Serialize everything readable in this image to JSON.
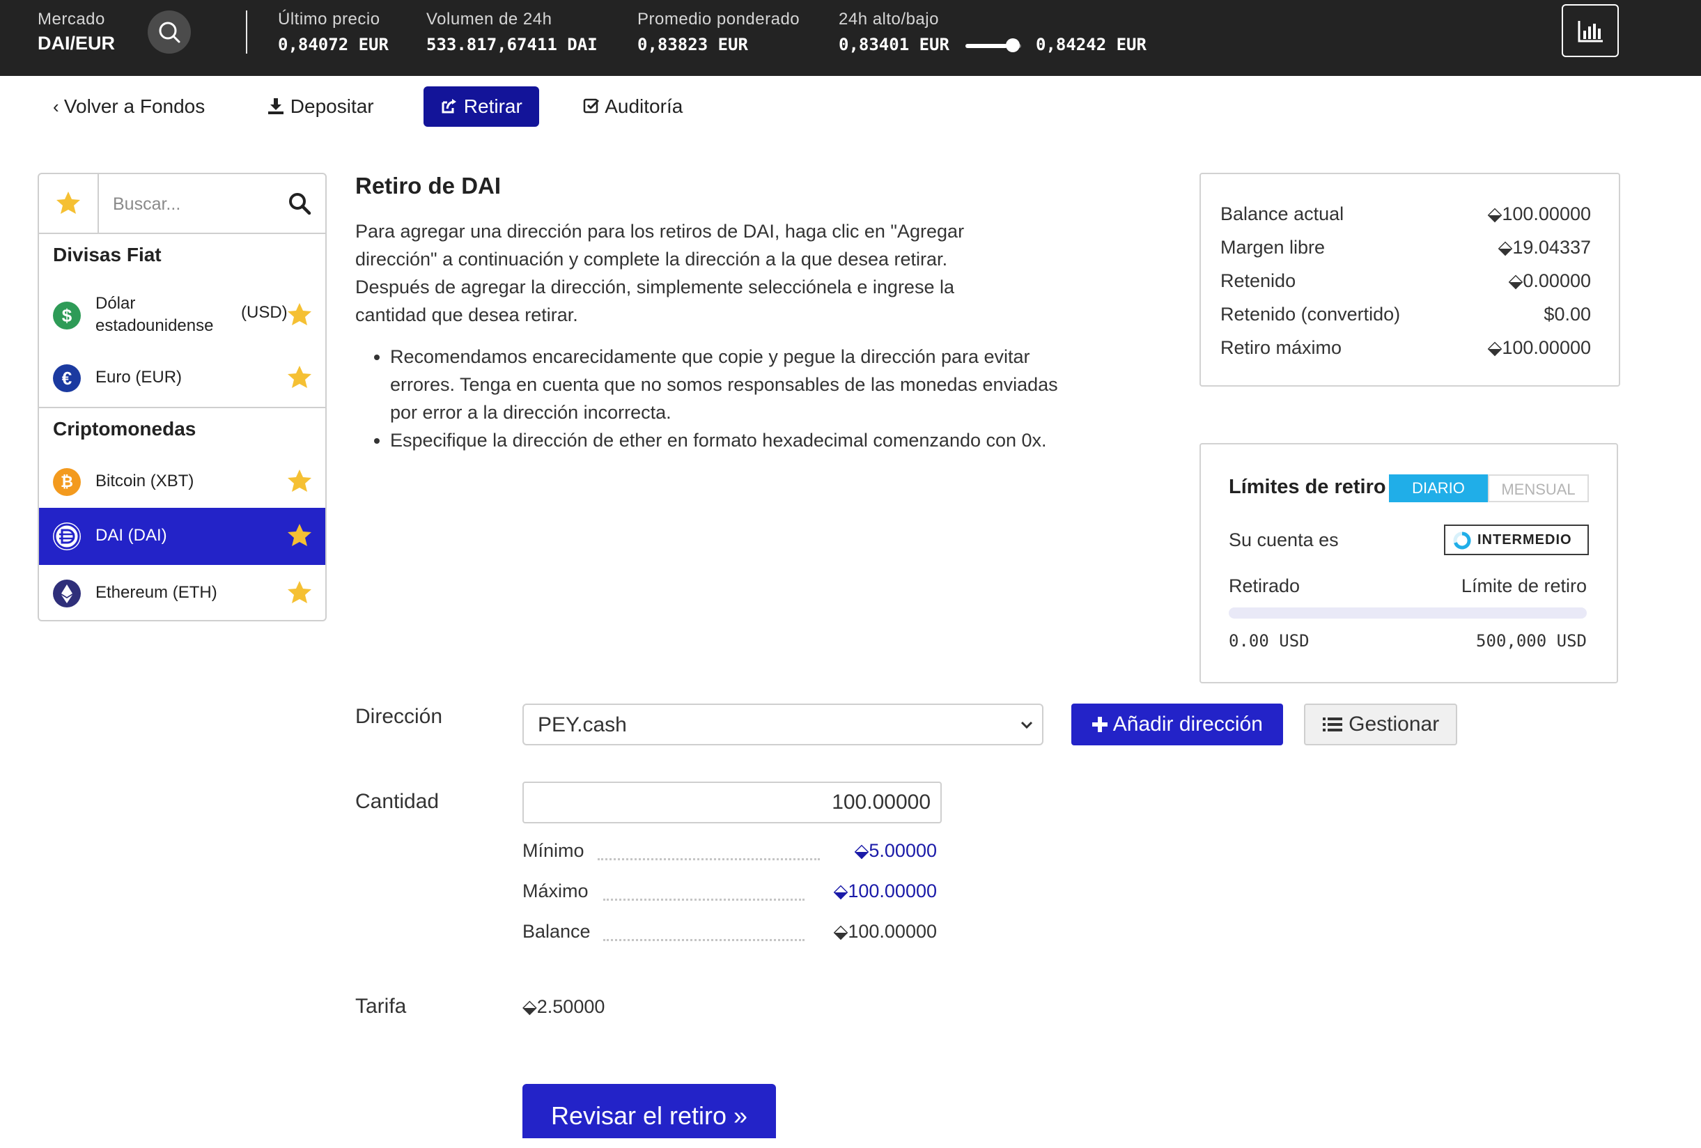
{
  "topbar": {
    "market_label": "Mercado",
    "market_value": "DAI/EUR",
    "last_price_label": "Último precio",
    "last_price_value": "0,84072 EUR",
    "volume_label": "Volumen de 24h",
    "volume_value": "533.817,67411 DAI",
    "weighted_label": "Promedio ponderado",
    "weighted_value": "0,83823 EUR",
    "highlow_label": "24h alto/bajo",
    "low_value": "0,83401 EUR",
    "high_value": "0,84242 EUR",
    "range_fraction": 0.75
  },
  "nav": {
    "back": "Volver a Fondos",
    "deposit": "Depositar",
    "withdraw": "Retirar",
    "audit": "Auditoría"
  },
  "sidebar": {
    "search_placeholder": "Buscar...",
    "fiat_heading": "Divisas Fiat",
    "crypto_heading": "Criptomonedas",
    "usd_name": "Dólar estadounidense",
    "usd_code": "(USD)",
    "eur_name": "Euro (EUR)",
    "xbt_name": "Bitcoin (XBT)",
    "dai_name": "DAI (DAI)",
    "eth_name": "Ethereum (ETH)"
  },
  "main": {
    "title": "Retiro de DAI",
    "paragraph": "Para agregar una dirección para los retiros de DAI, haga clic en \"Agregar dirección\" a continuación y complete la dirección a la que desea retirar. Después de agregar la dirección, simplemente selecciónela e ingrese la cantidad que desea retirar.",
    "bullets": [
      "Recomendamos encarecidamente que copie y pegue la dirección para evitar errores. Tenga en cuenta que no somos responsables de las monedas enviadas por error a la dirección incorrecta.",
      "Especifique la dirección de ether en formato hexadecimal comenzando con 0x."
    ]
  },
  "balance": {
    "rows": [
      {
        "label": "Balance actual",
        "value": "⬙100.00000"
      },
      {
        "label": "Margen libre",
        "value": "⬙19.04337"
      },
      {
        "label": "Retenido",
        "value": "⬙0.00000"
      },
      {
        "label": "Retenido (convertido)",
        "value": "$0.00"
      },
      {
        "label": "Retiro máximo",
        "value": "⬙100.00000"
      }
    ]
  },
  "limits": {
    "title": "Límites de retiro",
    "daily": "DIARIO",
    "monthly": "MENSUAL",
    "account_label": "Su cuenta es",
    "level": "INTERMEDIO",
    "withdrawn_label": "Retirado",
    "limit_label": "Límite de retiro",
    "withdrawn_value": "0.00 USD",
    "limit_value": "500,000 USD",
    "progress_fraction": 0
  },
  "form": {
    "address_label": "Dirección",
    "address_value": "PEY.cash",
    "add_address": "Añadir dirección",
    "manage": "Gestionar",
    "amount_label": "Cantidad",
    "amount_value": "100.00000",
    "min_label": "Mínimo",
    "min_value": "⬙5.00000",
    "max_label": "Máximo",
    "max_value": "⬙100.00000",
    "balance_label": "Balance",
    "balance_value": "⬙100.00000",
    "fee_label": "Tarifa",
    "fee_value": "⬙2.50000",
    "review": "Revisar el retiro »"
  },
  "colors": {
    "accent": "#2323c8",
    "topbar": "#232323",
    "toggle_on": "#20aee8",
    "star": "#f5c033"
  }
}
